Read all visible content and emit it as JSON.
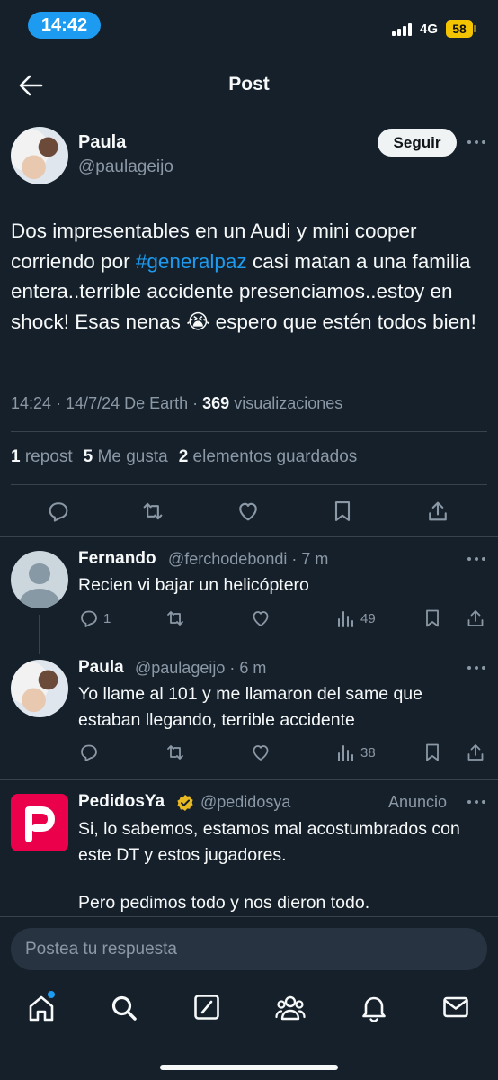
{
  "status_bar": {
    "time": "14:42",
    "network": "4G",
    "battery": "58"
  },
  "header": {
    "title": "Post"
  },
  "post": {
    "author_name": "Paula",
    "author_handle": "@paulageijo",
    "follow_label": "Seguir",
    "text_before": "Dos impresentables en un Audi y mini cooper corriendo por ",
    "hashtag": "#generalpaz",
    "text_after": " casi matan a una familia entera..terrible accidente presenciamos..estoy en shock! Esas nenas 😭 espero que estén todos bien!",
    "timestamp": "14:24 · 14/7/24 De Earth · ",
    "views_count": "369",
    "views_label": " visualizaciones",
    "reposts_count": "1",
    "reposts_label": " repost",
    "likes_count": "5",
    "likes_label": " Me gusta",
    "bookmarks_count": "2",
    "bookmarks_label": " elementos guardados"
  },
  "replies": [
    {
      "name": "Fernando",
      "handle_time": "@ferchodebondi · 7 m",
      "text": "Recien vi bajar un helicóptero",
      "reply_count": "1",
      "views": "49"
    },
    {
      "name": "Paula",
      "handle_time": "@paulageijo · 6 m",
      "text": "Yo llame al 101 y me llamaron del same que estaban llegando, terrible accidente",
      "reply_count": "",
      "views": "38"
    }
  ],
  "ad": {
    "name": "PedidosYa",
    "handle": "@pedidosya",
    "label": "Anuncio",
    "text_1": "Si, lo sabemos, estamos mal acostumbrados con este DT y estos jugadores.",
    "text_2": "Pero pedimos todo y nos dieron todo."
  },
  "composer": {
    "placeholder": "Postea tu respuesta"
  },
  "colors": {
    "accent": "#1d9bf0",
    "background": "#15202b",
    "muted": "#8b98a5",
    "ad_brand": "#ea004b",
    "battery": "#f5c400"
  }
}
